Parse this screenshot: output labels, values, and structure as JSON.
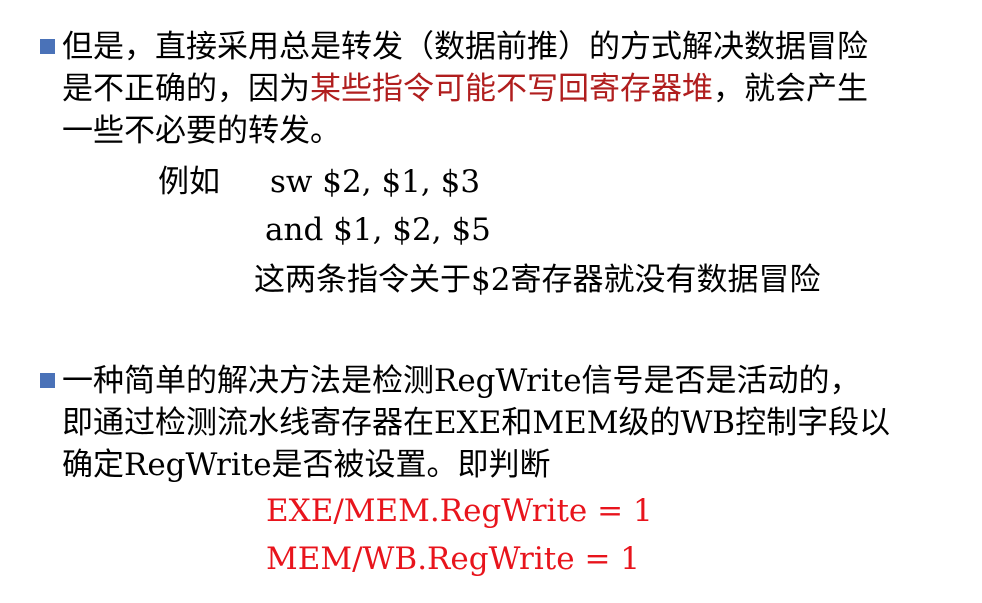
{
  "bullet1": {
    "line1": "但是，直接采用总是转发（数据前推）的方式解决数据冒险",
    "line2_before": "是不正确的，因为",
    "line2_highlight": "某些指令可能不写回寄存器堆",
    "line2_after": "，就会产生",
    "line3": "一些不必要的转发。",
    "example_label": "例如",
    "example_code1": "sw $2, $1, $3",
    "example_code2": "and $1, $2, $5",
    "example_note": "这两条指令关于$2寄存器就没有数据冒险"
  },
  "bullet2": {
    "line1": "一种简单的解决方法是检测RegWrite信号是否是活动的，",
    "line2": "即通过检测流水线寄存器在EXE和MEM级的WB控制字段以",
    "line3": "确定RegWrite是否被设置。即判断",
    "cond1": "EXE/MEM.RegWrite = 1",
    "cond2": "MEM/WB.RegWrite = 1"
  },
  "colors": {
    "bullet_marker": "#4a72b8",
    "highlight_dark_red": "#b01e1e",
    "highlight_red": "#e8141c"
  },
  "icons": {
    "bullet": "square-bullet-icon"
  }
}
